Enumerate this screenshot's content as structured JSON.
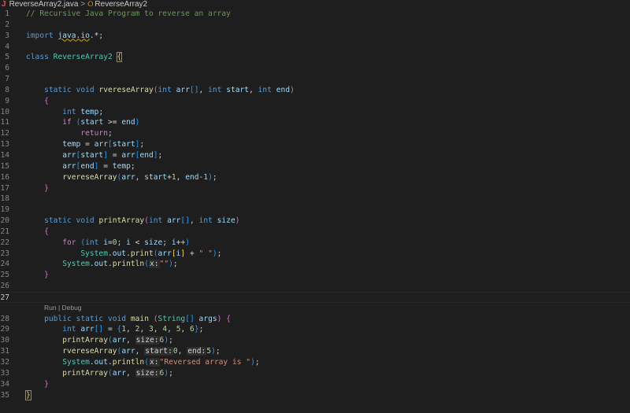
{
  "breadcrumb": {
    "file": "ReverseArray2.java",
    "symbol": "ReverseArray2"
  },
  "codelens": "Run | Debug",
  "lines": [
    {
      "n": "1",
      "tokens": [
        [
          "c-comment",
          "// Recursive Java Program to reverse an array"
        ]
      ]
    },
    {
      "n": "2",
      "tokens": []
    },
    {
      "n": "3",
      "tokens": [
        [
          "c-kw",
          "import"
        ],
        [
          "c-punc",
          " "
        ],
        [
          "c-var c-warn",
          "java.io"
        ],
        [
          "c-punc",
          ".*;"
        ]
      ]
    },
    {
      "n": "4",
      "tokens": []
    },
    {
      "n": "5",
      "tokens": [
        [
          "c-kw",
          "class"
        ],
        [
          "c-punc",
          " "
        ],
        [
          "c-class",
          "ReverseArray2"
        ],
        [
          "c-punc",
          " "
        ],
        [
          "c-br1 bracket-match",
          "{"
        ]
      ]
    },
    {
      "n": "6",
      "tokens": []
    },
    {
      "n": "7",
      "tokens": []
    },
    {
      "n": "8",
      "tokens": [
        [
          "c-punc",
          "    "
        ],
        [
          "c-kw",
          "static"
        ],
        [
          "c-punc",
          " "
        ],
        [
          "c-kw",
          "void"
        ],
        [
          "c-punc",
          " "
        ],
        [
          "c-fn",
          "rvereseArray"
        ],
        [
          "c-br2",
          "("
        ],
        [
          "c-kw",
          "int"
        ],
        [
          "c-punc",
          " "
        ],
        [
          "c-var",
          "arr"
        ],
        [
          "c-br3",
          "[]"
        ],
        [
          "c-punc",
          ", "
        ],
        [
          "c-kw",
          "int"
        ],
        [
          "c-punc",
          " "
        ],
        [
          "c-var",
          "start"
        ],
        [
          "c-punc",
          ", "
        ],
        [
          "c-kw",
          "int"
        ],
        [
          "c-punc",
          " "
        ],
        [
          "c-var",
          "end"
        ],
        [
          "c-br2",
          ")"
        ]
      ]
    },
    {
      "n": "9",
      "tokens": [
        [
          "c-punc",
          "    "
        ],
        [
          "c-br2",
          "{"
        ]
      ]
    },
    {
      "n": "10",
      "tokens": [
        [
          "c-punc",
          "        "
        ],
        [
          "c-kw",
          "int"
        ],
        [
          "c-punc",
          " "
        ],
        [
          "c-var",
          "temp"
        ],
        [
          "c-punc",
          ";"
        ]
      ]
    },
    {
      "n": "11",
      "tokens": [
        [
          "c-punc",
          "        "
        ],
        [
          "c-ctrl",
          "if"
        ],
        [
          "c-punc",
          " "
        ],
        [
          "c-br3",
          "("
        ],
        [
          "c-var",
          "start"
        ],
        [
          "c-punc",
          " >= "
        ],
        [
          "c-var",
          "end"
        ],
        [
          "c-br3",
          ")"
        ]
      ]
    },
    {
      "n": "12",
      "tokens": [
        [
          "c-punc",
          "            "
        ],
        [
          "c-ctrl",
          "return"
        ],
        [
          "c-punc",
          ";"
        ]
      ]
    },
    {
      "n": "13",
      "tokens": [
        [
          "c-punc",
          "        "
        ],
        [
          "c-var",
          "temp"
        ],
        [
          "c-punc",
          " = "
        ],
        [
          "c-var",
          "arr"
        ],
        [
          "c-br3",
          "["
        ],
        [
          "c-var",
          "start"
        ],
        [
          "c-br3",
          "]"
        ],
        [
          "c-punc",
          ";"
        ]
      ]
    },
    {
      "n": "14",
      "tokens": [
        [
          "c-punc",
          "        "
        ],
        [
          "c-var",
          "arr"
        ],
        [
          "c-br3",
          "["
        ],
        [
          "c-var",
          "start"
        ],
        [
          "c-br3",
          "]"
        ],
        [
          "c-punc",
          " = "
        ],
        [
          "c-var",
          "arr"
        ],
        [
          "c-br3",
          "["
        ],
        [
          "c-var",
          "end"
        ],
        [
          "c-br3",
          "]"
        ],
        [
          "c-punc",
          ";"
        ]
      ]
    },
    {
      "n": "15",
      "tokens": [
        [
          "c-punc",
          "        "
        ],
        [
          "c-var",
          "arr"
        ],
        [
          "c-br3",
          "["
        ],
        [
          "c-var",
          "end"
        ],
        [
          "c-br3",
          "]"
        ],
        [
          "c-punc",
          " = "
        ],
        [
          "c-var",
          "temp"
        ],
        [
          "c-punc",
          ";"
        ]
      ]
    },
    {
      "n": "16",
      "tokens": [
        [
          "c-punc",
          "        "
        ],
        [
          "c-fn",
          "rvereseArray"
        ],
        [
          "c-br3",
          "("
        ],
        [
          "c-var",
          "arr"
        ],
        [
          "c-punc",
          ", "
        ],
        [
          "c-var",
          "start"
        ],
        [
          "c-punc",
          "+"
        ],
        [
          "c-num",
          "1"
        ],
        [
          "c-punc",
          ", "
        ],
        [
          "c-var",
          "end"
        ],
        [
          "c-punc",
          "-"
        ],
        [
          "c-num",
          "1"
        ],
        [
          "c-br3",
          ")"
        ],
        [
          "c-punc",
          ";"
        ]
      ]
    },
    {
      "n": "17",
      "tokens": [
        [
          "c-punc",
          "    "
        ],
        [
          "c-br2",
          "}"
        ]
      ]
    },
    {
      "n": "18",
      "tokens": []
    },
    {
      "n": "19",
      "tokens": []
    },
    {
      "n": "20",
      "tokens": [
        [
          "c-punc",
          "    "
        ],
        [
          "c-kw",
          "static"
        ],
        [
          "c-punc",
          " "
        ],
        [
          "c-kw",
          "void"
        ],
        [
          "c-punc",
          " "
        ],
        [
          "c-fn",
          "printArray"
        ],
        [
          "c-br2",
          "("
        ],
        [
          "c-kw",
          "int"
        ],
        [
          "c-punc",
          " "
        ],
        [
          "c-var",
          "arr"
        ],
        [
          "c-br3",
          "[]"
        ],
        [
          "c-punc",
          ", "
        ],
        [
          "c-kw",
          "int"
        ],
        [
          "c-punc",
          " "
        ],
        [
          "c-var",
          "size"
        ],
        [
          "c-br2",
          ")"
        ]
      ]
    },
    {
      "n": "21",
      "tokens": [
        [
          "c-punc",
          "    "
        ],
        [
          "c-br2",
          "{"
        ]
      ]
    },
    {
      "n": "22",
      "tokens": [
        [
          "c-punc",
          "        "
        ],
        [
          "c-ctrl",
          "for"
        ],
        [
          "c-punc",
          " "
        ],
        [
          "c-br3",
          "("
        ],
        [
          "c-kw",
          "int"
        ],
        [
          "c-punc",
          " "
        ],
        [
          "c-var",
          "i"
        ],
        [
          "c-punc",
          "="
        ],
        [
          "c-num",
          "0"
        ],
        [
          "c-punc",
          "; "
        ],
        [
          "c-var",
          "i"
        ],
        [
          "c-punc",
          " < "
        ],
        [
          "c-var",
          "size"
        ],
        [
          "c-punc",
          "; "
        ],
        [
          "c-var",
          "i"
        ],
        [
          "c-punc",
          "++"
        ],
        [
          "c-br3",
          ")"
        ]
      ]
    },
    {
      "n": "23",
      "tokens": [
        [
          "c-punc",
          "            "
        ],
        [
          "c-class",
          "System"
        ],
        [
          "c-punc",
          "."
        ],
        [
          "c-var",
          "out"
        ],
        [
          "c-punc",
          "."
        ],
        [
          "c-fn",
          "print"
        ],
        [
          "c-br3",
          "("
        ],
        [
          "c-var",
          "arr"
        ],
        [
          "c-br1",
          "["
        ],
        [
          "c-var",
          "i"
        ],
        [
          "c-br1",
          "]"
        ],
        [
          "c-punc",
          " + "
        ],
        [
          "c-str",
          "\" \""
        ],
        [
          "c-br3",
          ")"
        ],
        [
          "c-punc",
          ";"
        ]
      ]
    },
    {
      "n": "24",
      "tokens": [
        [
          "c-punc",
          "        "
        ],
        [
          "c-class",
          "System"
        ],
        [
          "c-punc",
          "."
        ],
        [
          "c-var",
          "out"
        ],
        [
          "c-punc",
          "."
        ],
        [
          "c-fn",
          "println"
        ],
        [
          "c-br3",
          "("
        ],
        [
          "c-hint",
          "x:"
        ],
        [
          "c-str",
          "\"\""
        ],
        [
          "c-br3",
          ")"
        ],
        [
          "c-punc",
          ";"
        ]
      ]
    },
    {
      "n": "25",
      "tokens": [
        [
          "c-punc",
          "    "
        ],
        [
          "c-br2",
          "}"
        ]
      ]
    },
    {
      "n": "26",
      "tokens": []
    },
    {
      "n": "27",
      "current": true,
      "tokens": []
    },
    {
      "lens": true
    },
    {
      "n": "28",
      "tokens": [
        [
          "c-punc",
          "    "
        ],
        [
          "c-kw",
          "public"
        ],
        [
          "c-punc",
          " "
        ],
        [
          "c-kw",
          "static"
        ],
        [
          "c-punc",
          " "
        ],
        [
          "c-kw",
          "void"
        ],
        [
          "c-punc",
          " "
        ],
        [
          "c-fn",
          "main"
        ],
        [
          "c-punc",
          " "
        ],
        [
          "c-br2",
          "("
        ],
        [
          "c-class",
          "String"
        ],
        [
          "c-br3",
          "[]"
        ],
        [
          "c-punc",
          " "
        ],
        [
          "c-var",
          "args"
        ],
        [
          "c-br2",
          ")"
        ],
        [
          "c-punc",
          " "
        ],
        [
          "c-br2",
          "{"
        ]
      ]
    },
    {
      "n": "29",
      "tokens": [
        [
          "c-punc",
          "        "
        ],
        [
          "c-kw",
          "int"
        ],
        [
          "c-punc",
          " "
        ],
        [
          "c-var",
          "arr"
        ],
        [
          "c-br3",
          "[]"
        ],
        [
          "c-punc",
          " = "
        ],
        [
          "c-br3",
          "{"
        ],
        [
          "c-num",
          "1"
        ],
        [
          "c-punc",
          ", "
        ],
        [
          "c-num",
          "2"
        ],
        [
          "c-punc",
          ", "
        ],
        [
          "c-num",
          "3"
        ],
        [
          "c-punc",
          ", "
        ],
        [
          "c-num",
          "4"
        ],
        [
          "c-punc",
          ", "
        ],
        [
          "c-num",
          "5"
        ],
        [
          "c-punc",
          ", "
        ],
        [
          "c-num",
          "6"
        ],
        [
          "c-br3",
          "}"
        ],
        [
          "c-punc",
          ";"
        ]
      ]
    },
    {
      "n": "30",
      "tokens": [
        [
          "c-punc",
          "        "
        ],
        [
          "c-fn",
          "printArray"
        ],
        [
          "c-br3",
          "("
        ],
        [
          "c-var",
          "arr"
        ],
        [
          "c-punc",
          ", "
        ],
        [
          "c-hint",
          "size:"
        ],
        [
          "c-num",
          "6"
        ],
        [
          "c-br3",
          ")"
        ],
        [
          "c-punc",
          ";"
        ]
      ]
    },
    {
      "n": "31",
      "tokens": [
        [
          "c-punc",
          "        "
        ],
        [
          "c-fn",
          "rvereseArray"
        ],
        [
          "c-br3",
          "("
        ],
        [
          "c-var",
          "arr"
        ],
        [
          "c-punc",
          ", "
        ],
        [
          "c-hint",
          "start:"
        ],
        [
          "c-num",
          "0"
        ],
        [
          "c-punc",
          ", "
        ],
        [
          "c-hint",
          "end:"
        ],
        [
          "c-num",
          "5"
        ],
        [
          "c-br3",
          ")"
        ],
        [
          "c-punc",
          ";"
        ]
      ]
    },
    {
      "n": "32",
      "tokens": [
        [
          "c-punc",
          "        "
        ],
        [
          "c-class",
          "System"
        ],
        [
          "c-punc",
          "."
        ],
        [
          "c-var",
          "out"
        ],
        [
          "c-punc",
          "."
        ],
        [
          "c-fn",
          "println"
        ],
        [
          "c-br3",
          "("
        ],
        [
          "c-hint",
          "x:"
        ],
        [
          "c-str",
          "\"Reversed array is \""
        ],
        [
          "c-br3",
          ")"
        ],
        [
          "c-punc",
          ";"
        ]
      ]
    },
    {
      "n": "33",
      "tokens": [
        [
          "c-punc",
          "        "
        ],
        [
          "c-fn",
          "printArray"
        ],
        [
          "c-br3",
          "("
        ],
        [
          "c-var",
          "arr"
        ],
        [
          "c-punc",
          ", "
        ],
        [
          "c-hint",
          "size:"
        ],
        [
          "c-num",
          "6"
        ],
        [
          "c-br3",
          ")"
        ],
        [
          "c-punc",
          ";"
        ]
      ]
    },
    {
      "n": "34",
      "tokens": [
        [
          "c-punc",
          "    "
        ],
        [
          "c-br2",
          "}"
        ]
      ]
    },
    {
      "n": "35",
      "tokens": [
        [
          "c-br1 bracket-match",
          "}"
        ]
      ]
    }
  ]
}
